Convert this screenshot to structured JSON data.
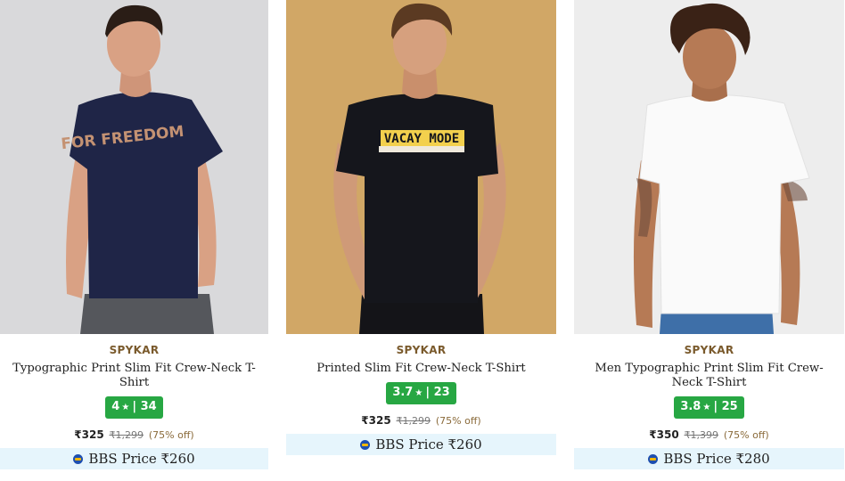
{
  "products": [
    {
      "brand": "SPYKAR",
      "title": "Typographic Print Slim Fit Crew-Neck T-Shirt",
      "rating_value": "4",
      "rating_count": "34",
      "price": "₹325",
      "mrp": "₹1,299",
      "discount": "(75% off)",
      "bbs_price": "BBS Price ₹260",
      "print_text": "FOR FREEDOM",
      "bg_color": "#d4d4d6",
      "shirt_color": "#1f2547"
    },
    {
      "brand": "SPYKAR",
      "title": "Printed Slim Fit Crew-Neck T-Shirt",
      "rating_value": "3.7",
      "rating_count": "23",
      "price": "₹325",
      "mrp": "₹1,299",
      "discount": "(75% off)",
      "bbs_price": "BBS Price ₹260",
      "print_text": "VACAY MODE",
      "bg_color": "#d1a766",
      "shirt_color": "#15161c"
    },
    {
      "brand": "SPYKAR",
      "title": "Men Typographic Print Slim Fit Crew-Neck T-Shirt",
      "rating_value": "3.8",
      "rating_count": "25",
      "price": "₹350",
      "mrp": "₹1,399",
      "discount": "(75% off)",
      "bbs_price": "BBS Price ₹280",
      "print_text": "",
      "bg_color": "#ededed",
      "shirt_color": "#fafafa"
    }
  ],
  "colors": {
    "rating_badge": "#27a743",
    "brand_text": "#7a5a2c",
    "bbs_band": "#e6f5fc"
  },
  "icons": {
    "rating": "star-icon",
    "bbs": "bbs-logo-icon"
  }
}
